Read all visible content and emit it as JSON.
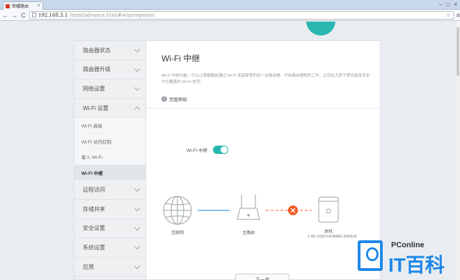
{
  "browser": {
    "tab_title": "荣耀路由",
    "tab_close": "×",
    "window_controls": [
      "–",
      "□",
      "×"
    ],
    "url_host": "192.168.3.1",
    "url_path": "/html/advance.html#wlanrepeater",
    "nav": {
      "back": "←",
      "forward": "→",
      "reload": "C",
      "menu": "≡",
      "star": "☆"
    }
  },
  "sidebar": {
    "items": [
      {
        "label": "路由器状态"
      },
      {
        "label": "路由器升级"
      },
      {
        "label": "网络设置"
      },
      {
        "label": "Wi-Fi 设置"
      },
      {
        "label": "远程访问"
      },
      {
        "label": "存储共享"
      },
      {
        "label": "安全设置"
      },
      {
        "label": "系统设置"
      },
      {
        "label": "应用"
      }
    ],
    "subitems": [
      {
        "label": "Wi-Fi 高级"
      },
      {
        "label": "Wi-Fi 访问控制"
      },
      {
        "label": "客人 Wi-Fi"
      },
      {
        "label": "Wi-Fi 中继"
      }
    ]
  },
  "main": {
    "title": "Wi-Fi 中继",
    "description": "Wi-Fi 中继功能，可以让荣耀路由通过 Wi-Fi 连接家里的另一台路由器。开启路由器转的工作，让您在大房子里也能享受全方位覆盖的 Wi-Fi 信号。",
    "help_icon": "?",
    "help_label": "页面帮助",
    "wifi_relay_label": "Wi-Fi 中继",
    "wifi_relay_on": true,
    "nodes": {
      "internet": "互联网",
      "main_router": "主路由",
      "this_device": "本机",
      "ssid": "2.4G SSID:HUAWEI-Z5KBJF"
    },
    "next_button": "下一步"
  },
  "watermark": {
    "brand_top": "PConline",
    "brand_big": "IT百科"
  },
  "colors": {
    "accent": "#2ab7b1",
    "error": "#f15a24",
    "link_line": "#5aa9e6",
    "watermark_blue": "#1e87e8"
  }
}
